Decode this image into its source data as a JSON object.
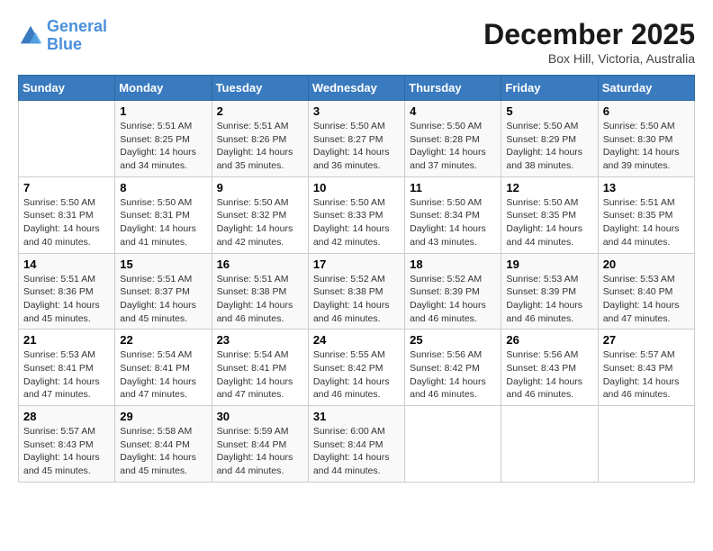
{
  "logo": {
    "line1": "General",
    "line2": "Blue"
  },
  "title": "December 2025",
  "location": "Box Hill, Victoria, Australia",
  "days_header": [
    "Sunday",
    "Monday",
    "Tuesday",
    "Wednesday",
    "Thursday",
    "Friday",
    "Saturday"
  ],
  "weeks": [
    [
      {
        "num": "",
        "info": ""
      },
      {
        "num": "1",
        "info": "Sunrise: 5:51 AM\nSunset: 8:25 PM\nDaylight: 14 hours\nand 34 minutes."
      },
      {
        "num": "2",
        "info": "Sunrise: 5:51 AM\nSunset: 8:26 PM\nDaylight: 14 hours\nand 35 minutes."
      },
      {
        "num": "3",
        "info": "Sunrise: 5:50 AM\nSunset: 8:27 PM\nDaylight: 14 hours\nand 36 minutes."
      },
      {
        "num": "4",
        "info": "Sunrise: 5:50 AM\nSunset: 8:28 PM\nDaylight: 14 hours\nand 37 minutes."
      },
      {
        "num": "5",
        "info": "Sunrise: 5:50 AM\nSunset: 8:29 PM\nDaylight: 14 hours\nand 38 minutes."
      },
      {
        "num": "6",
        "info": "Sunrise: 5:50 AM\nSunset: 8:30 PM\nDaylight: 14 hours\nand 39 minutes."
      }
    ],
    [
      {
        "num": "7",
        "info": "Sunrise: 5:50 AM\nSunset: 8:31 PM\nDaylight: 14 hours\nand 40 minutes."
      },
      {
        "num": "8",
        "info": "Sunrise: 5:50 AM\nSunset: 8:31 PM\nDaylight: 14 hours\nand 41 minutes."
      },
      {
        "num": "9",
        "info": "Sunrise: 5:50 AM\nSunset: 8:32 PM\nDaylight: 14 hours\nand 42 minutes."
      },
      {
        "num": "10",
        "info": "Sunrise: 5:50 AM\nSunset: 8:33 PM\nDaylight: 14 hours\nand 42 minutes."
      },
      {
        "num": "11",
        "info": "Sunrise: 5:50 AM\nSunset: 8:34 PM\nDaylight: 14 hours\nand 43 minutes."
      },
      {
        "num": "12",
        "info": "Sunrise: 5:50 AM\nSunset: 8:35 PM\nDaylight: 14 hours\nand 44 minutes."
      },
      {
        "num": "13",
        "info": "Sunrise: 5:51 AM\nSunset: 8:35 PM\nDaylight: 14 hours\nand 44 minutes."
      }
    ],
    [
      {
        "num": "14",
        "info": "Sunrise: 5:51 AM\nSunset: 8:36 PM\nDaylight: 14 hours\nand 45 minutes."
      },
      {
        "num": "15",
        "info": "Sunrise: 5:51 AM\nSunset: 8:37 PM\nDaylight: 14 hours\nand 45 minutes."
      },
      {
        "num": "16",
        "info": "Sunrise: 5:51 AM\nSunset: 8:38 PM\nDaylight: 14 hours\nand 46 minutes."
      },
      {
        "num": "17",
        "info": "Sunrise: 5:52 AM\nSunset: 8:38 PM\nDaylight: 14 hours\nand 46 minutes."
      },
      {
        "num": "18",
        "info": "Sunrise: 5:52 AM\nSunset: 8:39 PM\nDaylight: 14 hours\nand 46 minutes."
      },
      {
        "num": "19",
        "info": "Sunrise: 5:53 AM\nSunset: 8:39 PM\nDaylight: 14 hours\nand 46 minutes."
      },
      {
        "num": "20",
        "info": "Sunrise: 5:53 AM\nSunset: 8:40 PM\nDaylight: 14 hours\nand 47 minutes."
      }
    ],
    [
      {
        "num": "21",
        "info": "Sunrise: 5:53 AM\nSunset: 8:41 PM\nDaylight: 14 hours\nand 47 minutes."
      },
      {
        "num": "22",
        "info": "Sunrise: 5:54 AM\nSunset: 8:41 PM\nDaylight: 14 hours\nand 47 minutes."
      },
      {
        "num": "23",
        "info": "Sunrise: 5:54 AM\nSunset: 8:41 PM\nDaylight: 14 hours\nand 47 minutes."
      },
      {
        "num": "24",
        "info": "Sunrise: 5:55 AM\nSunset: 8:42 PM\nDaylight: 14 hours\nand 46 minutes."
      },
      {
        "num": "25",
        "info": "Sunrise: 5:56 AM\nSunset: 8:42 PM\nDaylight: 14 hours\nand 46 minutes."
      },
      {
        "num": "26",
        "info": "Sunrise: 5:56 AM\nSunset: 8:43 PM\nDaylight: 14 hours\nand 46 minutes."
      },
      {
        "num": "27",
        "info": "Sunrise: 5:57 AM\nSunset: 8:43 PM\nDaylight: 14 hours\nand 46 minutes."
      }
    ],
    [
      {
        "num": "28",
        "info": "Sunrise: 5:57 AM\nSunset: 8:43 PM\nDaylight: 14 hours\nand 45 minutes."
      },
      {
        "num": "29",
        "info": "Sunrise: 5:58 AM\nSunset: 8:44 PM\nDaylight: 14 hours\nand 45 minutes."
      },
      {
        "num": "30",
        "info": "Sunrise: 5:59 AM\nSunset: 8:44 PM\nDaylight: 14 hours\nand 44 minutes."
      },
      {
        "num": "31",
        "info": "Sunrise: 6:00 AM\nSunset: 8:44 PM\nDaylight: 14 hours\nand 44 minutes."
      },
      {
        "num": "",
        "info": ""
      },
      {
        "num": "",
        "info": ""
      },
      {
        "num": "",
        "info": ""
      }
    ]
  ]
}
